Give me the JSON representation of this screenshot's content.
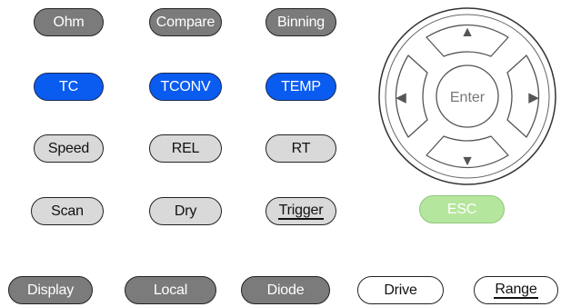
{
  "keys": {
    "ohm": "Ohm",
    "compare": "Compare",
    "binning": "Binning",
    "tc": "TC",
    "tconv": "TCONV",
    "temp": "TEMP",
    "speed": "Speed",
    "rel": "REL",
    "rt": "RT",
    "scan": "Scan",
    "dry": "Dry",
    "trigger": "Trigger",
    "esc": "ESC",
    "display": "Display",
    "local": "Local",
    "diode": "Diode",
    "drive": "Drive",
    "range": "Range"
  },
  "dpad": {
    "up": "▲",
    "down": "▼",
    "left": "◀",
    "right": "▶",
    "enter": "Enter"
  },
  "colors": {
    "dark_key": "#7b7b7b",
    "blue_key": "#0a5cf0",
    "light_key": "#d9d9d9",
    "esc_key": "#b5e69d"
  }
}
